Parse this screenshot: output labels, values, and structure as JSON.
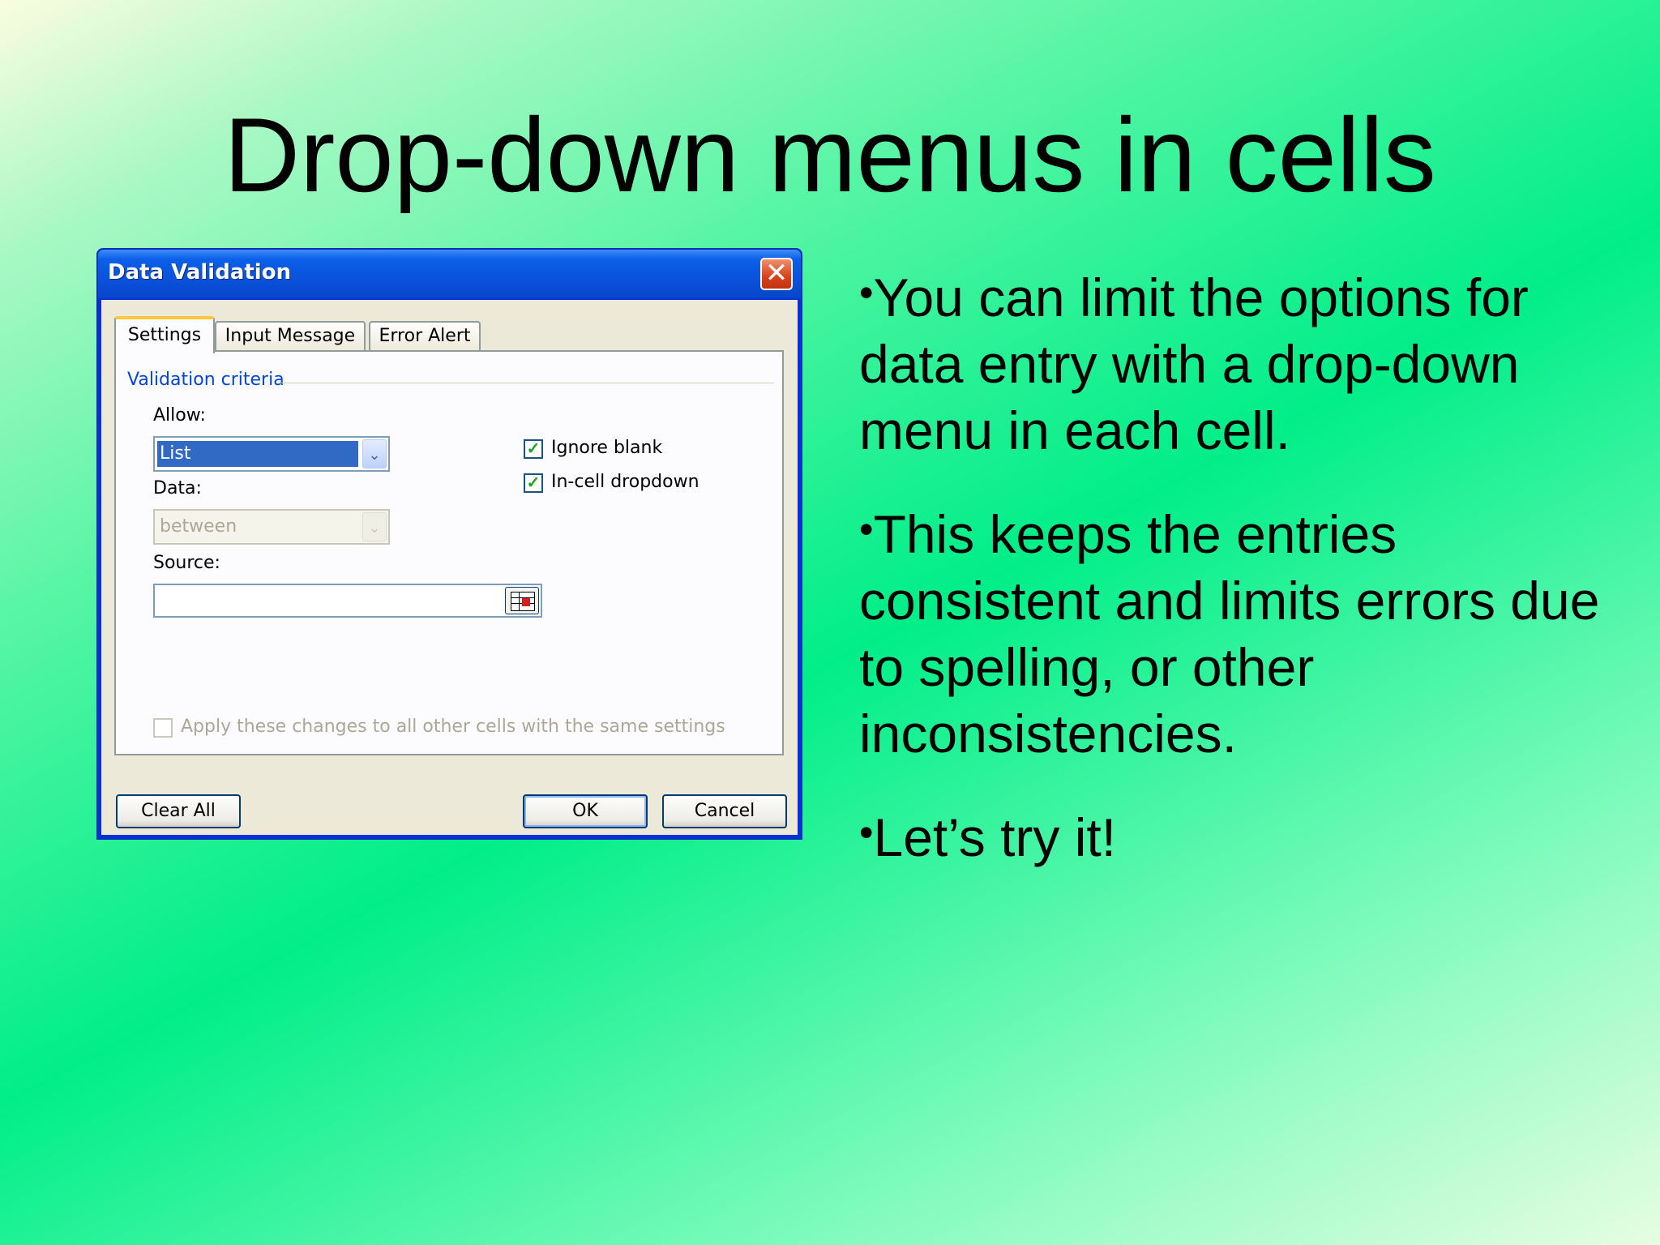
{
  "slide": {
    "title": "Drop-down menus in cells",
    "bullets": [
      "You can limit the options for data entry with a drop-down menu in each cell.",
      "This keeps the entries consistent and limits errors due to spelling, or other inconsistencies.",
      "Let’s try it!"
    ]
  },
  "dialog": {
    "title": "Data Validation",
    "close_glyph": "✕",
    "tabs": [
      {
        "label": "Settings",
        "active": true
      },
      {
        "label": "Input Message",
        "active": false
      },
      {
        "label": "Error Alert",
        "active": false
      }
    ],
    "group_label": "Validation criteria",
    "allow": {
      "label": "Allow:",
      "value": "List"
    },
    "data": {
      "label": "Data:",
      "value": "between"
    },
    "source": {
      "label": "Source:",
      "value": ""
    },
    "ignore_blank": {
      "label": "Ignore blank",
      "checked": true
    },
    "in_cell_dropdown": {
      "label": "In-cell dropdown",
      "checked": true
    },
    "apply_all": {
      "label": "Apply these changes to all other cells with the same settings",
      "checked": false
    },
    "buttons": {
      "clear_all": "Clear All",
      "ok": "OK",
      "cancel": "Cancel"
    },
    "check_glyph": "✓",
    "arrow_glyph": "⌄"
  }
}
